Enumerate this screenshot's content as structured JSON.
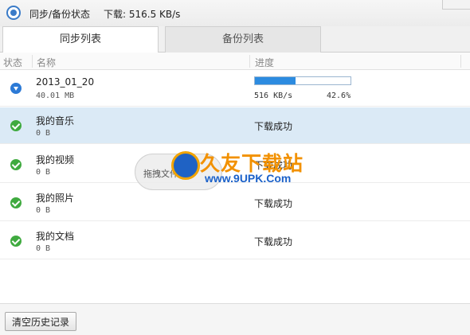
{
  "window": {
    "title": "同步/备份状态",
    "download_speed": "下载: 516.5 KB/s"
  },
  "tabs": [
    {
      "label": "同步列表",
      "active": true
    },
    {
      "label": "备份列表",
      "active": false
    }
  ],
  "columns": {
    "status": "状态",
    "name": "名称",
    "progress": "进度"
  },
  "rows": [
    {
      "name": "2013_01_20",
      "size": "40.01 MB",
      "status_icon": "download-icon",
      "state": "",
      "rate": "516 KB/s",
      "percent": "42.6%",
      "progress": 0.426,
      "selected": false
    },
    {
      "name": "我的音乐",
      "size": "0 B",
      "status_icon": "check-icon",
      "state": "下载成功",
      "selected": true
    },
    {
      "name": "我的视频",
      "size": "0 B",
      "status_icon": "check-icon",
      "state": "下载成功",
      "selected": false
    },
    {
      "name": "我的照片",
      "size": "0 B",
      "status_icon": "check-icon",
      "state": "下载成功",
      "selected": false
    },
    {
      "name": "我的文档",
      "size": "0 B",
      "status_icon": "check-icon",
      "state": "下载成功",
      "selected": false
    }
  ],
  "overlay": {
    "drag_hint": "拖拽文件"
  },
  "footer": {
    "clear_history_label": "清空历史记录"
  },
  "watermark": {
    "brand": "久友下载站",
    "url": "www.9UPK.Com"
  },
  "colors": {
    "accent": "#2c8be0",
    "success": "#3faa3f",
    "selected_row": "#dbeaf6",
    "watermark_orange": "#f29100",
    "watermark_blue": "#1b61c9"
  }
}
